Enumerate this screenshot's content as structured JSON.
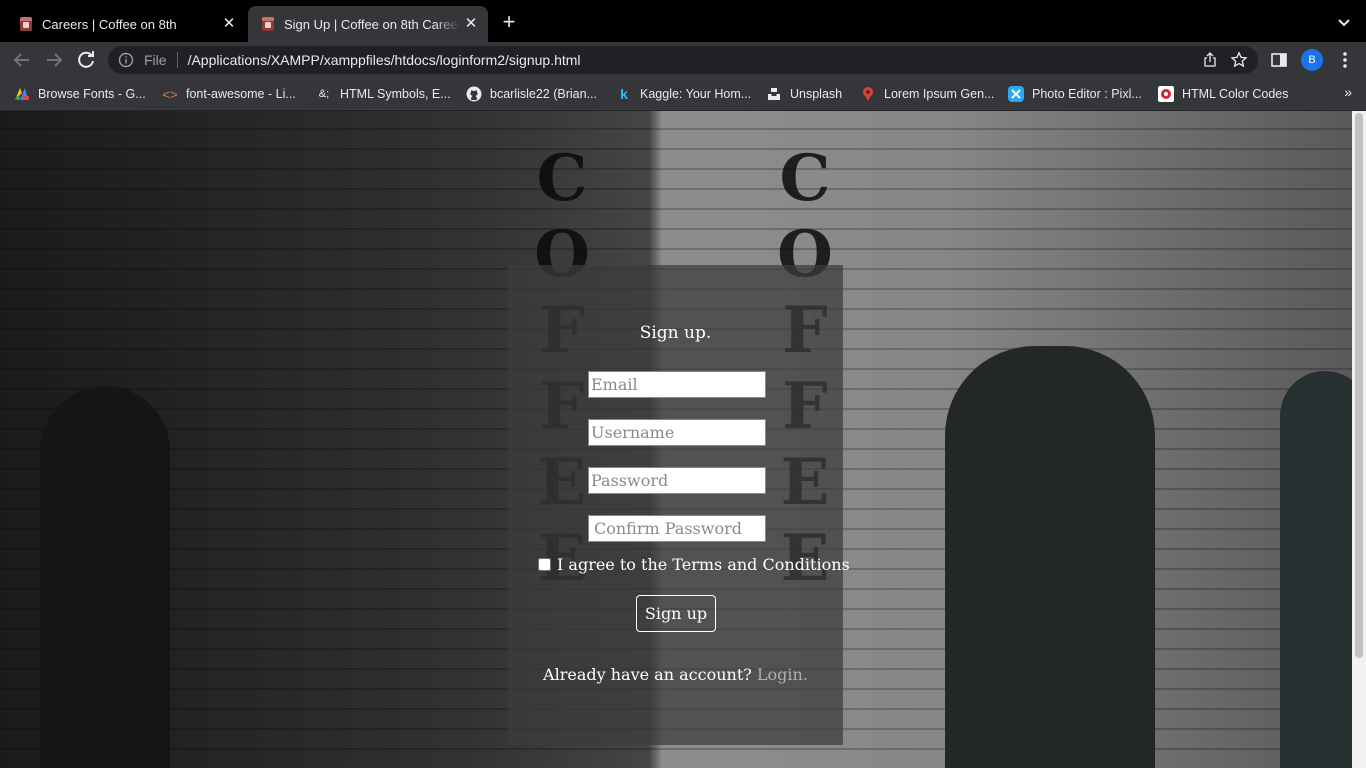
{
  "tabs": [
    {
      "title": "Careers | Coffee on 8th",
      "active": false
    },
    {
      "title": "Sign Up | Coffee on 8th Careers",
      "active": true
    }
  ],
  "toolbar": {
    "scheme": "File",
    "url": "/Applications/XAMPP/xamppfiles/htdocs/loginform2/signup.html",
    "profile_initial": "B"
  },
  "bookmarks": [
    {
      "label": "Browse Fonts - G...",
      "icon": "google-fonts-icon"
    },
    {
      "label": "font-awesome - Li...",
      "icon": "code-brackets-icon"
    },
    {
      "label": "HTML Symbols, E...",
      "icon": "ampersand-icon"
    },
    {
      "label": "bcarlisle22 (Brian...",
      "icon": "github-icon"
    },
    {
      "label": "Kaggle: Your Hom...",
      "icon": "kaggle-icon"
    },
    {
      "label": "Unsplash",
      "icon": "unsplash-icon"
    },
    {
      "label": "Lorem Ipsum Gen...",
      "icon": "lorem-ipsum-icon"
    },
    {
      "label": "Photo Editor : Pixl...",
      "icon": "pixlr-icon"
    },
    {
      "label": "HTML Color Codes",
      "icon": "color-codes-icon"
    }
  ],
  "form": {
    "heading": "Sign up.",
    "email_placeholder": "Email",
    "username_placeholder": "Username",
    "password_placeholder": "Password",
    "confirm_placeholder": "Confirm Password",
    "terms_label": "I agree to the Terms and Conditions",
    "submit_label": "Sign up",
    "already_text": "Already have an account?",
    "login_link": "Login."
  },
  "background_sign": {
    "left": "COFFEE",
    "right": "COFFEE"
  },
  "colors": {
    "panel": "#3c3c3c",
    "link": "#b0b0b0",
    "profile": "#1a73e8"
  }
}
